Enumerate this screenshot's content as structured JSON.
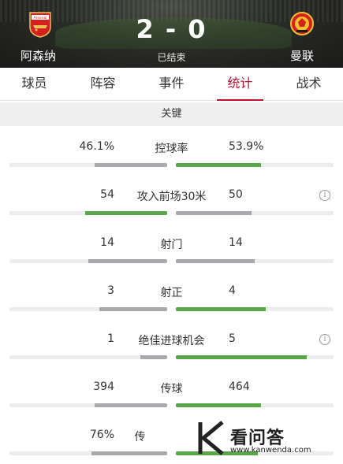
{
  "header": {
    "home_team": "阿森纳",
    "away_team": "曼联",
    "score": "2 - 0",
    "status": "已结束",
    "home_crest_text": "Arsenal"
  },
  "tabs": [
    {
      "label": "球员"
    },
    {
      "label": "阵容"
    },
    {
      "label": "事件"
    },
    {
      "label": "统计",
      "active": true
    },
    {
      "label": "战术"
    }
  ],
  "section": {
    "title": "关键"
  },
  "stats": [
    {
      "label": "控球率",
      "home": "46.1%",
      "away": "53.9%",
      "home_share": 0.461,
      "away_share": 0.539,
      "winner": "away",
      "info": false
    },
    {
      "label": "攻入前场30米",
      "home": "54",
      "away": "50",
      "home_share": 0.52,
      "away_share": 0.48,
      "winner": "home",
      "info": true
    },
    {
      "label": "射门",
      "home": "14",
      "away": "14",
      "home_share": 0.5,
      "away_share": 0.5,
      "winner": "none",
      "info": false
    },
    {
      "label": "射正",
      "home": "3",
      "away": "4",
      "home_share": 0.43,
      "away_share": 0.57,
      "winner": "away",
      "info": false
    },
    {
      "label": "绝佳进球机会",
      "home": "1",
      "away": "5",
      "home_share": 0.17,
      "away_share": 0.83,
      "winner": "away",
      "info": true
    },
    {
      "label": "传球",
      "home": "394",
      "away": "464",
      "home_share": 0.459,
      "away_share": 0.541,
      "winner": "away",
      "info": false
    },
    {
      "label": "传",
      "home": "76%",
      "away": "",
      "home_share": 0.48,
      "away_share": 0.52,
      "winner": "away",
      "info": false
    }
  ],
  "watermark": {
    "text": "看问答",
    "url": "www.kanwenda.com"
  },
  "colors": {
    "accent": "#c8102e",
    "win": "#5aa64a",
    "lose": "#a9a9ad"
  },
  "icons": {
    "info": "info-icon"
  }
}
